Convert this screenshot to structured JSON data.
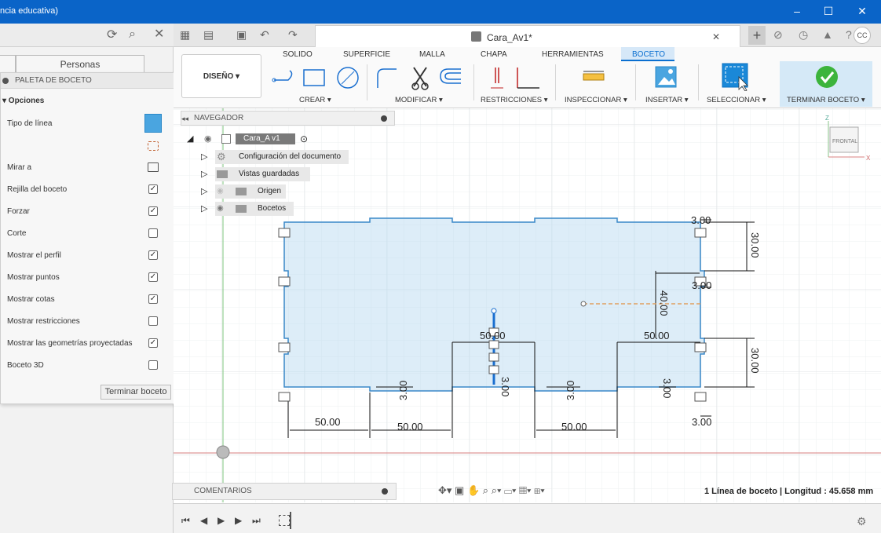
{
  "window": {
    "title": "ncia educativa)",
    "minimize": "–",
    "maximize": "☐",
    "close": "✕"
  },
  "left_panel": {
    "personas_tab": "Personas"
  },
  "palette": {
    "header": "PALETA DE BOCETO",
    "section": "▾ Opciones",
    "rows": [
      {
        "label": "Tipo de línea",
        "type": "icon"
      },
      {
        "label": "",
        "type": "icon"
      },
      {
        "label": "Mirar a",
        "type": "icon"
      },
      {
        "label": "Rejilla del boceto",
        "checked": true
      },
      {
        "label": "Forzar",
        "checked": true
      },
      {
        "label": "Corte",
        "checked": false
      },
      {
        "label": "Mostrar el perfil",
        "checked": true
      },
      {
        "label": "Mostrar puntos",
        "checked": true
      },
      {
        "label": "Mostrar cotas",
        "checked": true
      },
      {
        "label": "Mostrar restricciones",
        "checked": false
      },
      {
        "label": "Mostrar las geometrías proyectadas",
        "checked": true
      },
      {
        "label": "Boceto 3D",
        "checked": false
      }
    ],
    "finish_button": "Terminar boceto"
  },
  "document_tab": {
    "title": "Cara_Av1*",
    "close": "✕",
    "new_tab": "+"
  },
  "user": {
    "initials": "CC"
  },
  "ribbon": {
    "workspace": "DISEÑO ▾",
    "tabs": [
      "SOLIDO",
      "SUPERFICIE",
      "MALLA",
      "CHAPA",
      "HERRAMIENTAS",
      "BOCETO"
    ],
    "active_tab": "BOCETO",
    "groups": [
      "CREAR ▾",
      "MODIFICAR ▾",
      "RESTRICCIONES ▾",
      "INSPECCIONAR ▾",
      "INSERTAR ▾",
      "SELECCIONAR ▾",
      "TERMINAR BOCETO ▾"
    ]
  },
  "navigator": {
    "header": "NAVEGADOR",
    "root": "Cara_A v1",
    "items": [
      "Configuración del documento",
      "Vistas guardadas",
      "Origen",
      "Bocetos"
    ]
  },
  "viewcube": {
    "face": "FRONTAL",
    "axis_z": "Z",
    "axis_x": "X"
  },
  "sketch": {
    "dimensions": [
      "3.00",
      "30.00",
      "40.00",
      "3.00",
      "50.00",
      "50.00",
      "30.00",
      "3.00",
      "3.00",
      "3.00",
      "3.00",
      "50.00",
      "50.00",
      "50.00",
      "3.00"
    ]
  },
  "comments": {
    "label": "COMENTARIOS"
  },
  "status": {
    "text": "1 Línea de boceto | Longitud : 45.658 mm"
  }
}
